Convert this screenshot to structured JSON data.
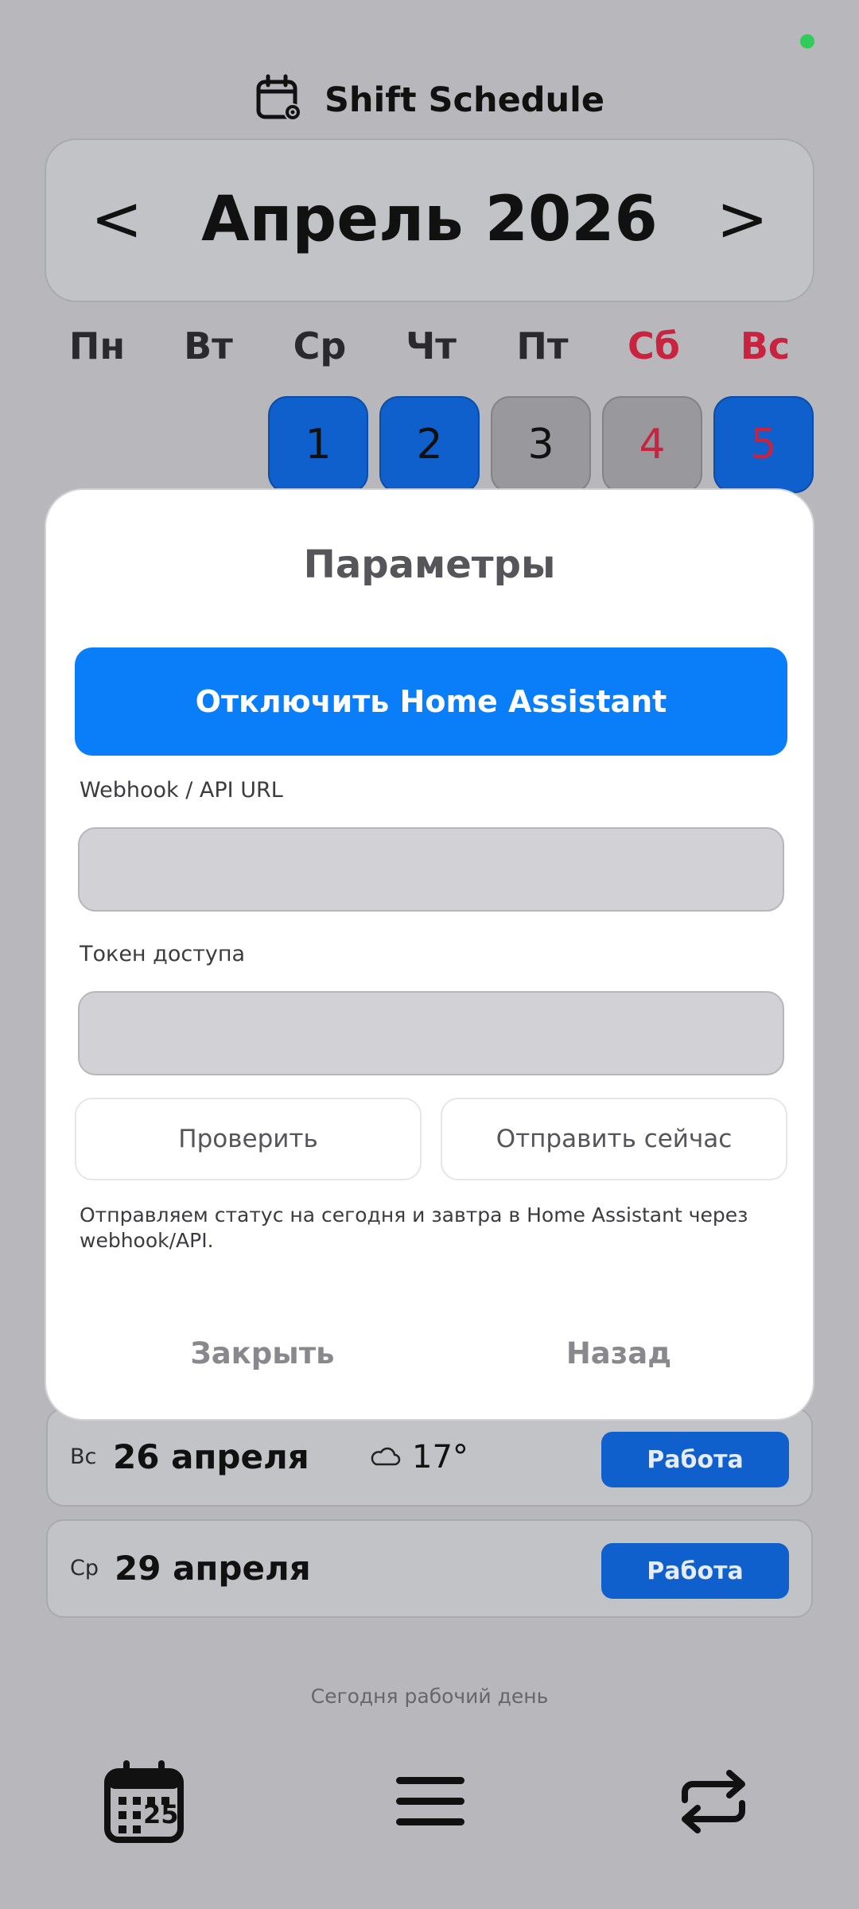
{
  "header": {
    "title": "Shift Schedule",
    "icon": "calendar-gear-icon"
  },
  "calendar": {
    "prev_label": "<",
    "next_label": ">",
    "month_title": "Апрель 2026",
    "weekdays": [
      "Пн",
      "Вт",
      "Ср",
      "Чт",
      "Пт",
      "Сб",
      "Вс"
    ],
    "visible_days": [
      "1",
      "2",
      "3",
      "4",
      "5"
    ]
  },
  "list": [
    {
      "dow": "Вс",
      "date": "26 апреля",
      "weather_icon": "cloud-icon",
      "temperature": "17°",
      "status": "Работа"
    },
    {
      "dow": "Ср",
      "date": "29 апреля",
      "status": "Работа"
    }
  ],
  "today_status": "Сегодня рабочий день",
  "bottom_nav": {
    "calendar_day": "25"
  },
  "modal": {
    "title": "Параметры",
    "toggle_label": "Отключить Home Assistant",
    "webhook_label": "Webhook / API URL",
    "webhook_value": "",
    "token_label": "Токен доступа",
    "token_value": "",
    "check_label": "Проверить",
    "send_label": "Отправить сейчас",
    "note": "Отправляем статус на сегодня и завтра в Home Assistant через webhook/API.",
    "close_label": "Закрыть",
    "back_label": "Назад"
  },
  "colors": {
    "accent": "#0a7ef9",
    "work_day": "#0f5fcc",
    "weekend_text": "#c8233f",
    "online_dot": "#2fcc5a"
  }
}
